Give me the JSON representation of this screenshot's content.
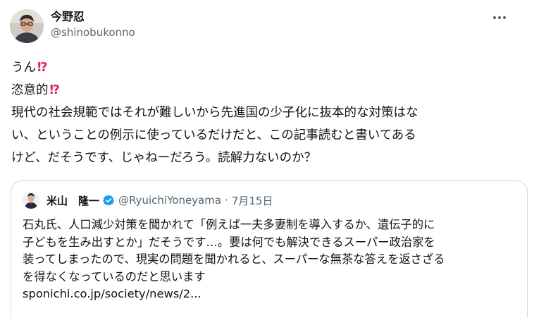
{
  "author": {
    "display_name": "今野忍",
    "handle": "@shinobukonno"
  },
  "menu": {
    "more_icon": "ellipsis-icon"
  },
  "tweet": {
    "line1": "うん",
    "line1_emoji": "⁉",
    "line2": "恣意的",
    "line2_emoji": "⁉",
    "line3": "現代の社会規範ではそれが難しいから先進国の少子化に抜本的な対策はな",
    "line4": "い、ということの例示に使っているだけだと、この記事読むと書いてある",
    "line5": "けど、だそうです、じゃねーだろう。読解力ないのか？"
  },
  "quote": {
    "display_name": "米山　隆一",
    "verified_icon": "verified-badge-icon",
    "handle": "@RyuichiYoneyama",
    "separator": "·",
    "date": "7月15日",
    "line1": "石丸氏、人口減少対策を聞かれて「例えば一夫多妻制を導入するか、遺伝子的に",
    "line2": "子どもを生み出すとか」だそうです…。要は何でも解決できるスーパー政治家を",
    "line3": "装ってしまったので、現実の問題を聞かれると、スーパーな無茶な答えを返さざる",
    "line4": "を得なくなっているのだと思います",
    "link": "sponichi.co.jp/society/news/2..."
  },
  "colors": {
    "text": "#0f1419",
    "secondary": "#536471",
    "interrobang": "#e0245e",
    "verified": "#1d9bf0",
    "border": "#cfd9de"
  }
}
